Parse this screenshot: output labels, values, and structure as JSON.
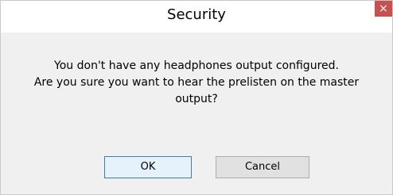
{
  "dialog": {
    "title": "Security",
    "close_symbol": "×",
    "message_lines": [
      "You don't have any headphones output configured.",
      "Are you sure you want to hear the prelisten on the master",
      "output?"
    ],
    "buttons": {
      "ok_label": "OK",
      "cancel_label": "Cancel"
    }
  },
  "colors": {
    "close_button_bg": "#c75050",
    "dialog_bg": "#f0f0f0",
    "titlebar_bg": "#ffffff"
  }
}
